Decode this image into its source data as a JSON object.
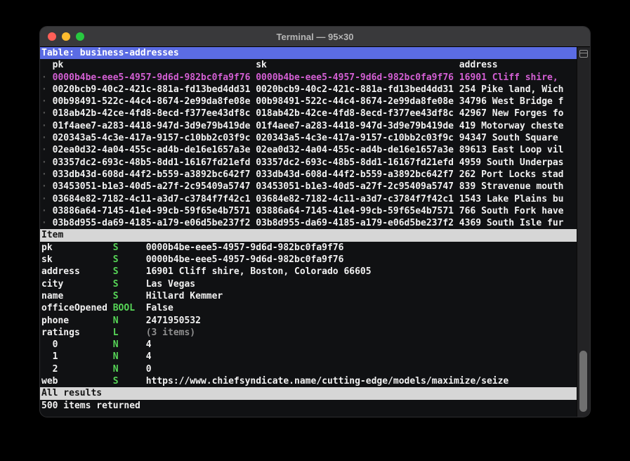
{
  "window": {
    "title": "Terminal — 95×30",
    "traffic_lights": {
      "close": "#ff5f57",
      "minimize": "#febc2e",
      "zoom": "#28c840"
    }
  },
  "colors": {
    "table_header_bg": "#5b6ce4",
    "section_bar_bg": "#d6d6d6",
    "selected_row": "#d35fd3",
    "type_letter": "#57d657",
    "dim_text": "#8f8f8f",
    "bullet": "#555555"
  },
  "table_view": {
    "header": "Table: business-addresses",
    "columns": {
      "pk": "pk",
      "sk": "sk",
      "address": "address"
    },
    "rows": [
      {
        "bullet": "·",
        "pk": "0000b4be-eee5-4957-9d6d-982bc0fa9f76",
        "sk": "0000b4be-eee5-4957-9d6d-982bc0fa9f76",
        "address": "16901 Cliff shire,",
        "selected": true
      },
      {
        "bullet": "·",
        "pk": "0020bcb9-40c2-421c-881a-fd13bed4dd31",
        "sk": "0020bcb9-40c2-421c-881a-fd13bed4dd31",
        "address": "254 Pike land, Wich"
      },
      {
        "bullet": "·",
        "pk": "00b98491-522c-44c4-8674-2e99da8fe08e",
        "sk": "00b98491-522c-44c4-8674-2e99da8fe08e",
        "address": "34796 West Bridge f"
      },
      {
        "bullet": "·",
        "pk": "018ab42b-42ce-4fd8-8ecd-f377ee43df8c",
        "sk": "018ab42b-42ce-4fd8-8ecd-f377ee43df8c",
        "address": "42967 New Forges fo"
      },
      {
        "bullet": "·",
        "pk": "01f4aee7-a283-4418-947d-3d9e79b419de",
        "sk": "01f4aee7-a283-4418-947d-3d9e79b419de",
        "address": "419 Motorway cheste"
      },
      {
        "bullet": "·",
        "pk": "020343a5-4c3e-417a-9157-c10bb2c03f9c",
        "sk": "020343a5-4c3e-417a-9157-c10bb2c03f9c",
        "address": "94347 South Square"
      },
      {
        "bullet": "·",
        "pk": "02ea0d32-4a04-455c-ad4b-de16e1657a3e",
        "sk": "02ea0d32-4a04-455c-ad4b-de16e1657a3e",
        "address": "89613 East Loop vil"
      },
      {
        "bullet": "·",
        "pk": "03357dc2-693c-48b5-8dd1-16167fd21efd",
        "sk": "03357dc2-693c-48b5-8dd1-16167fd21efd",
        "address": "4959 South Underpas"
      },
      {
        "bullet": "·",
        "pk": "033db43d-608d-44f2-b559-a3892bc642f7",
        "sk": "033db43d-608d-44f2-b559-a3892bc642f7",
        "address": "262 Port Locks stad"
      },
      {
        "bullet": "·",
        "pk": "03453051-b1e3-40d5-a27f-2c95409a5747",
        "sk": "03453051-b1e3-40d5-a27f-2c95409a5747",
        "address": "839 Stravenue mouth"
      },
      {
        "bullet": "·",
        "pk": "03684e82-7182-4c11-a3d7-c3784f7f42c1",
        "sk": "03684e82-7182-4c11-a3d7-c3784f7f42c1",
        "address": "1543 Lake Plains bu"
      },
      {
        "bullet": "·",
        "pk": "03886a64-7145-41e4-99cb-59f65e4b7571",
        "sk": "03886a64-7145-41e4-99cb-59f65e4b7571",
        "address": "766 South Fork have"
      },
      {
        "bullet": "·",
        "pk": "03b8d955-da69-4185-a179-e06d5be237f2",
        "sk": "03b8d955-da69-4185-a179-e06d5be237f2",
        "address": "4369 South Isle fur"
      }
    ]
  },
  "item_view": {
    "header": "Item",
    "attributes": [
      {
        "key": "pk",
        "type": "S",
        "value": "0000b4be-eee5-4957-9d6d-982bc0fa9f76"
      },
      {
        "key": "sk",
        "type": "S",
        "value": "0000b4be-eee5-4957-9d6d-982bc0fa9f76"
      },
      {
        "key": "address",
        "type": "S",
        "value": "16901 Cliff shire, Boston, Colorado 66605"
      },
      {
        "key": "city",
        "type": "S",
        "value": "Las Vegas"
      },
      {
        "key": "name",
        "type": "S",
        "value": "Hillard Kemmer"
      },
      {
        "key": "officeOpened",
        "type": "BOOL",
        "value": "False"
      },
      {
        "key": "phone",
        "type": "N",
        "value": "2471950532"
      },
      {
        "key": "ratings",
        "type": "L",
        "value": "(3 items)",
        "dim": true
      },
      {
        "key": "  0",
        "type": "N",
        "value": "4"
      },
      {
        "key": "  1",
        "type": "N",
        "value": "4"
      },
      {
        "key": "  2",
        "type": "N",
        "value": "0"
      },
      {
        "key": "web",
        "type": "S",
        "value": "https://www.chiefsyndicate.name/cutting-edge/models/maximize/seize"
      }
    ]
  },
  "footer": {
    "results_bar": "All results",
    "status": "500 items returned"
  }
}
